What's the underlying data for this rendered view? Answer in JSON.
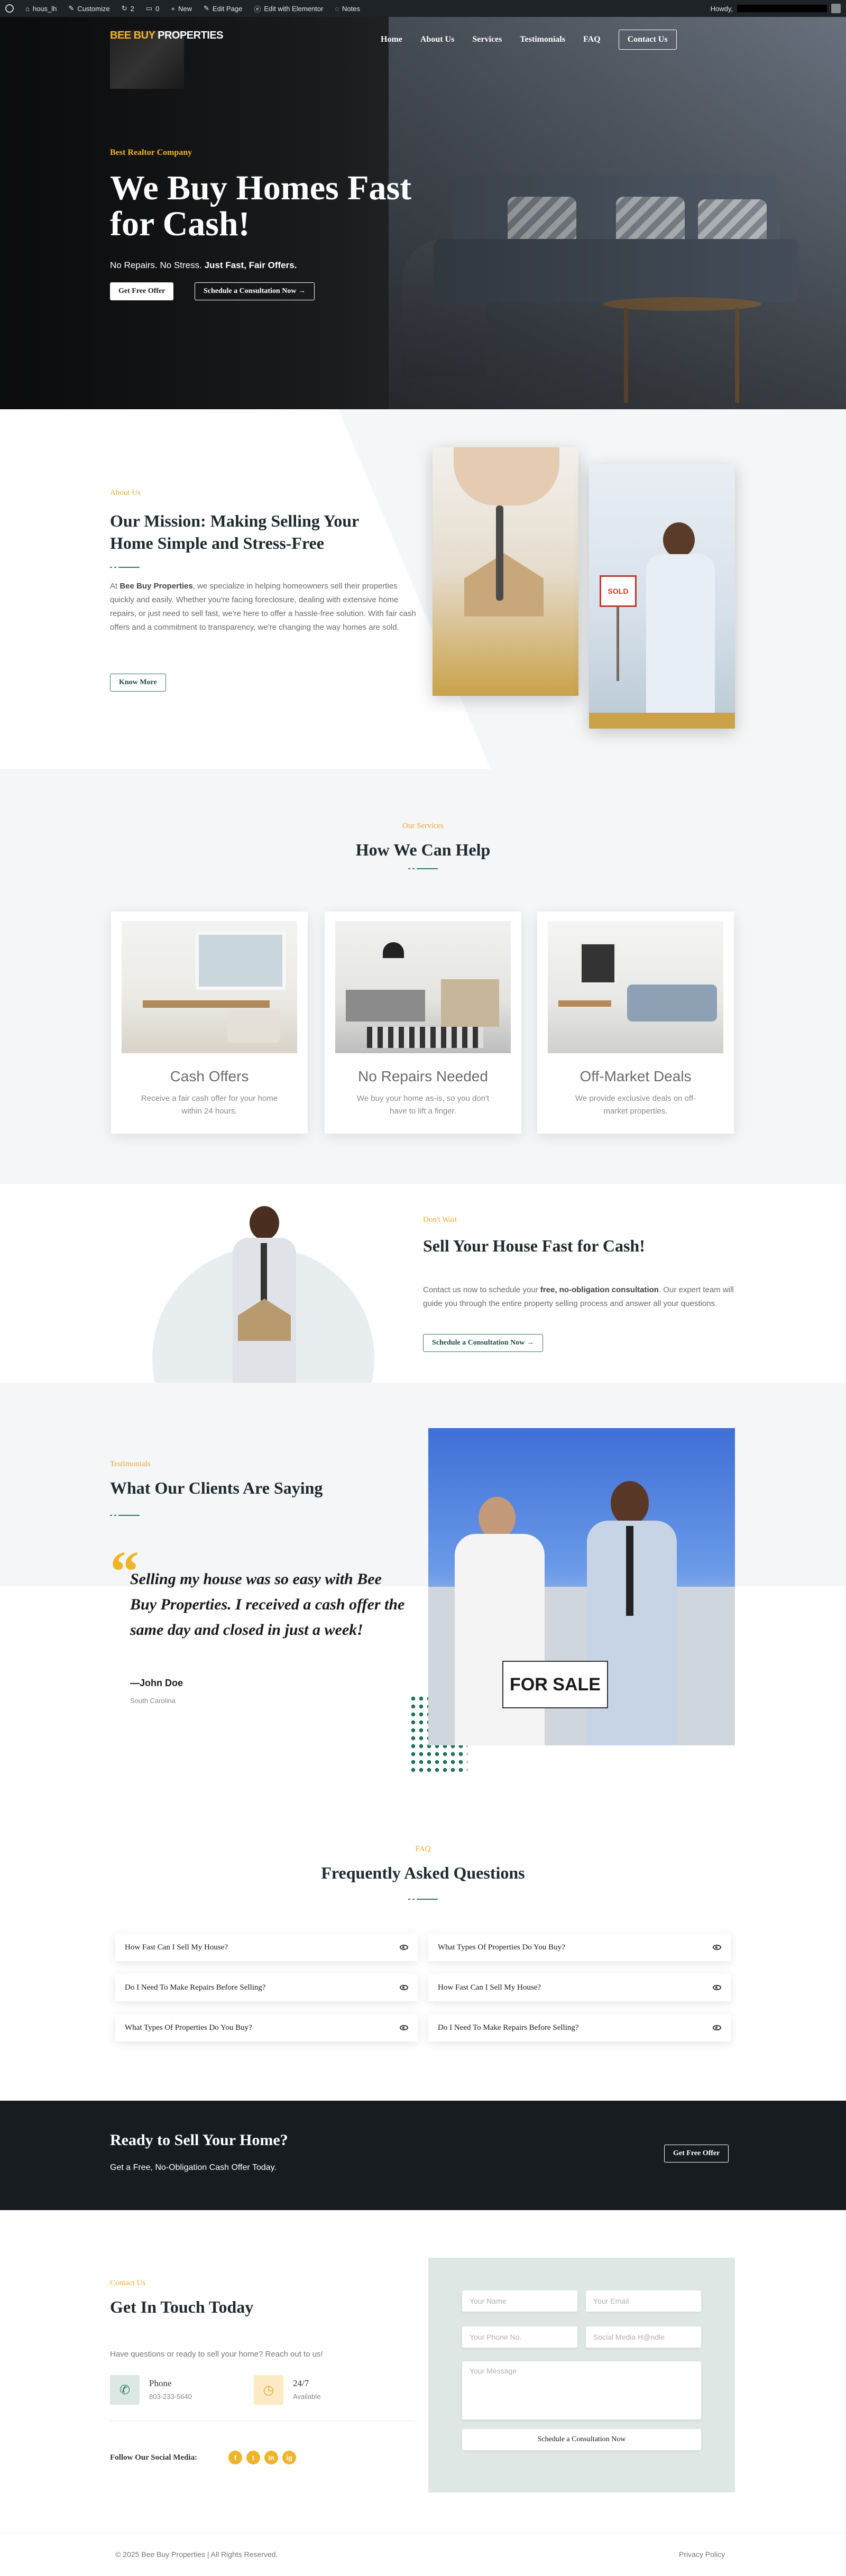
{
  "admin_bar": {
    "site_name": "hous_lh",
    "customize": "Customize",
    "comments_count": "2",
    "updates_count": "0",
    "new": "New",
    "edit_page": "Edit Page",
    "edit_elementor": "Edit with Elementor",
    "notes": "Notes",
    "howdy": "Howdy,"
  },
  "header": {
    "logo_part1": "BEE BUY",
    "logo_part2": "PROPERTIES",
    "nav": [
      "Home",
      "About Us",
      "Services",
      "Testimonials",
      "FAQ"
    ],
    "contact_button": "Contact Us"
  },
  "hero": {
    "kicker": "Best Realtor Company",
    "title": "We Buy Homes Fast for Cash!",
    "subtitle_plain": "No Repairs. No Stress. ",
    "subtitle_bold": "Just Fast, Fair Offers.",
    "btn_primary": "Get Free Offer",
    "btn_secondary": "Schedule a Consultation Now →"
  },
  "about": {
    "kicker": "About Us",
    "title": "Our Mission: Making Selling Your Home Simple and Stress-Free",
    "body_pre": "At ",
    "body_brand": "Bee Buy Properties",
    "body_post": ", we specialize in helping homeowners sell their properties quickly and easily. Whether you're facing foreclosure, dealing with extensive home repairs, or just need to sell fast, we're here to offer a hassle-free solution. With fair cash offers and a commitment to transparency, we're changing the way homes are sold.",
    "button": "Know More",
    "sign_text": "SOLD"
  },
  "services": {
    "kicker": "Our Services",
    "title": "How We Can Help",
    "cards": [
      {
        "title": "Cash Offers",
        "desc": "Receive a fair cash offer for your home within 24 hours."
      },
      {
        "title": "No Repairs Needed",
        "desc": "We buy your home as-is, so you don't have to lift a finger."
      },
      {
        "title": "Off-Market Deals",
        "desc": "We provide exclusive deals on off-market properties."
      }
    ]
  },
  "sell_fast": {
    "kicker": "Don't Wait",
    "title": "Sell Your House Fast for Cash!",
    "body_pre": "Contact us now to schedule your ",
    "body_bold": "free, no-obligation consultation",
    "body_post": ". Our expert team will guide you through the entire property selling process and answer all your questions.",
    "button": "Schedule a Consultation Now →"
  },
  "testimonials": {
    "kicker": "Testimonials",
    "title": "What Our Clients Are Saying",
    "quote": "Selling my house was so easy with Bee Buy Properties. I received a cash offer the same day and closed in just a week!",
    "author": "—John Doe",
    "location": "South Carolina",
    "sign_text": "FOR SALE"
  },
  "faq": {
    "kicker": "FAQ",
    "title": "Frequently Asked Questions",
    "left": [
      "How Fast Can I Sell My House?",
      "Do I Need To Make Repairs Before Selling?",
      "What Types Of Properties Do You Buy?"
    ],
    "right": [
      "What Types Of Properties Do You Buy?",
      "How Fast Can I Sell My House?",
      "Do I Need To Make Repairs Before Selling?"
    ]
  },
  "cta": {
    "title": "Ready to Sell Your Home?",
    "subtitle": "Get a Free, No-Obligation Cash Offer Today.",
    "button": "Get Free Offer"
  },
  "contact": {
    "kicker": "Contact Us",
    "title": "Get In Touch Today",
    "subtitle": "Have questions or ready to sell your home? Reach out to us!",
    "phone_label": "Phone",
    "phone_value": "803-233-5640",
    "hours_label": "24/7",
    "hours_value": "Available",
    "social_label": "Follow Our Social Media:",
    "socials": [
      "f",
      "t",
      "in",
      "ig"
    ],
    "form": {
      "name_placeholder": "Your Name",
      "email_placeholder": "Your Email",
      "phone_placeholder": "Your Phone No.",
      "social_placeholder": "Social Media H@ndle",
      "message_placeholder": "Your Message",
      "submit": "Schedule a Consultation Now"
    }
  },
  "footer": {
    "copyright": "© 2025 Bee Buy Properties | All Rights Reserved.",
    "privacy": "Privacy Policy"
  },
  "colors": {
    "accent_gold": "#f0b429",
    "accent_green": "#2f7a68",
    "dark": "#161c20",
    "admin_bar": "#1d2327"
  }
}
